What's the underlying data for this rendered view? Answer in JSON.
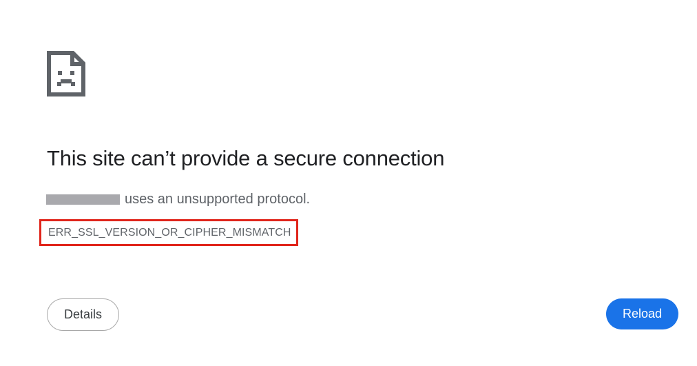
{
  "icons": {
    "error_page": "broken-page-sad-face-icon"
  },
  "error": {
    "title": "This site can’t provide a secure connection",
    "message_suffix": "uses an unsupported protocol.",
    "code": "ERR_SSL_VERSION_OR_CIPHER_MISMATCH"
  },
  "buttons": {
    "details": "Details",
    "reload": "Reload"
  },
  "colors": {
    "title_text": "#202124",
    "secondary_text": "#5f6368",
    "redaction": "#a9a9ad",
    "highlight_border": "#e0251b",
    "primary_button": "#1a73e8",
    "primary_button_text": "#ffffff"
  }
}
